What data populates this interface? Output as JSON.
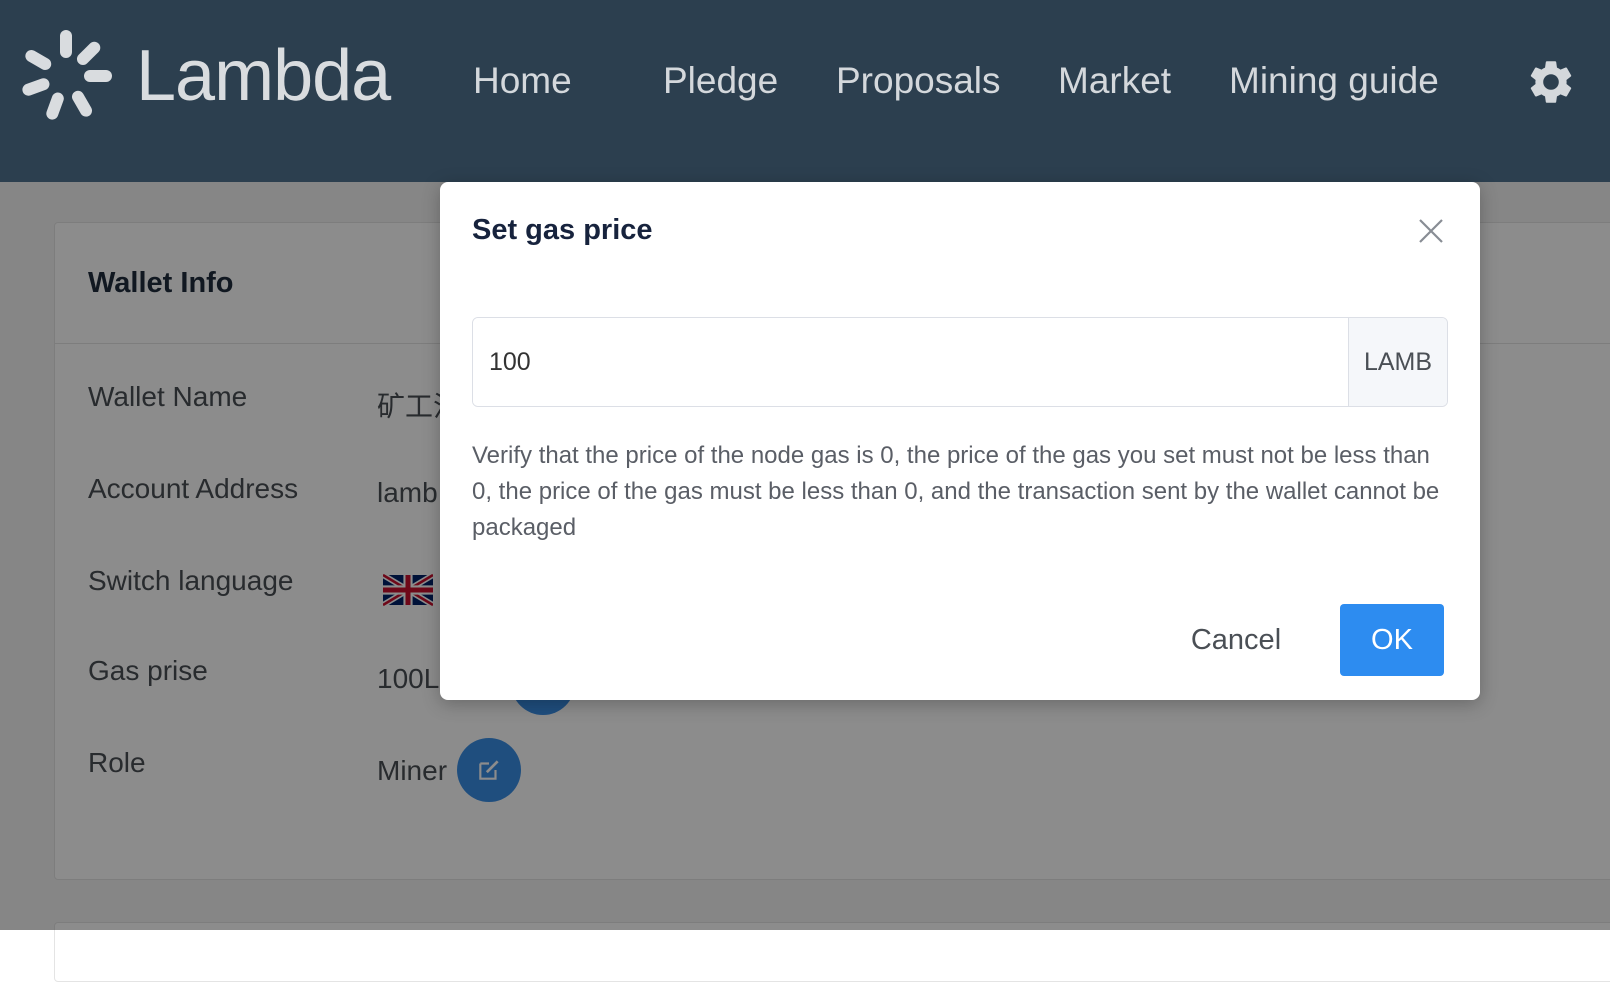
{
  "header": {
    "logo_text": "Lambda",
    "nav": {
      "home": "Home",
      "pledge": "Pledge",
      "proposals": "Proposals",
      "market": "Market",
      "mining_guide": "Mining guide"
    },
    "settings_icon": "gear-icon"
  },
  "wallet_info": {
    "title": "Wallet Info",
    "rows": [
      {
        "label": "Wallet Name",
        "value": "矿工注"
      },
      {
        "label": "Account Address",
        "value": "lamb"
      },
      {
        "label": "Switch language",
        "value": "uk-flag-icon"
      },
      {
        "label": "Gas prise",
        "value": "100L"
      },
      {
        "label": "Role",
        "value": "Miner"
      }
    ]
  },
  "modal": {
    "title": "Set gas price",
    "input_value": "100",
    "input_suffix": "LAMB",
    "description": "Verify that the price of the node gas is 0, the price of the gas you set must not be less than 0, the price of the gas must be less than 0, and the transaction sent by the wallet cannot be packaged",
    "cancel_label": "Cancel",
    "ok_label": "OK"
  },
  "colors": {
    "header_bg": "#2c3f4f",
    "primary": "#2d8cf0",
    "edit_button": "#3a8ee6"
  }
}
